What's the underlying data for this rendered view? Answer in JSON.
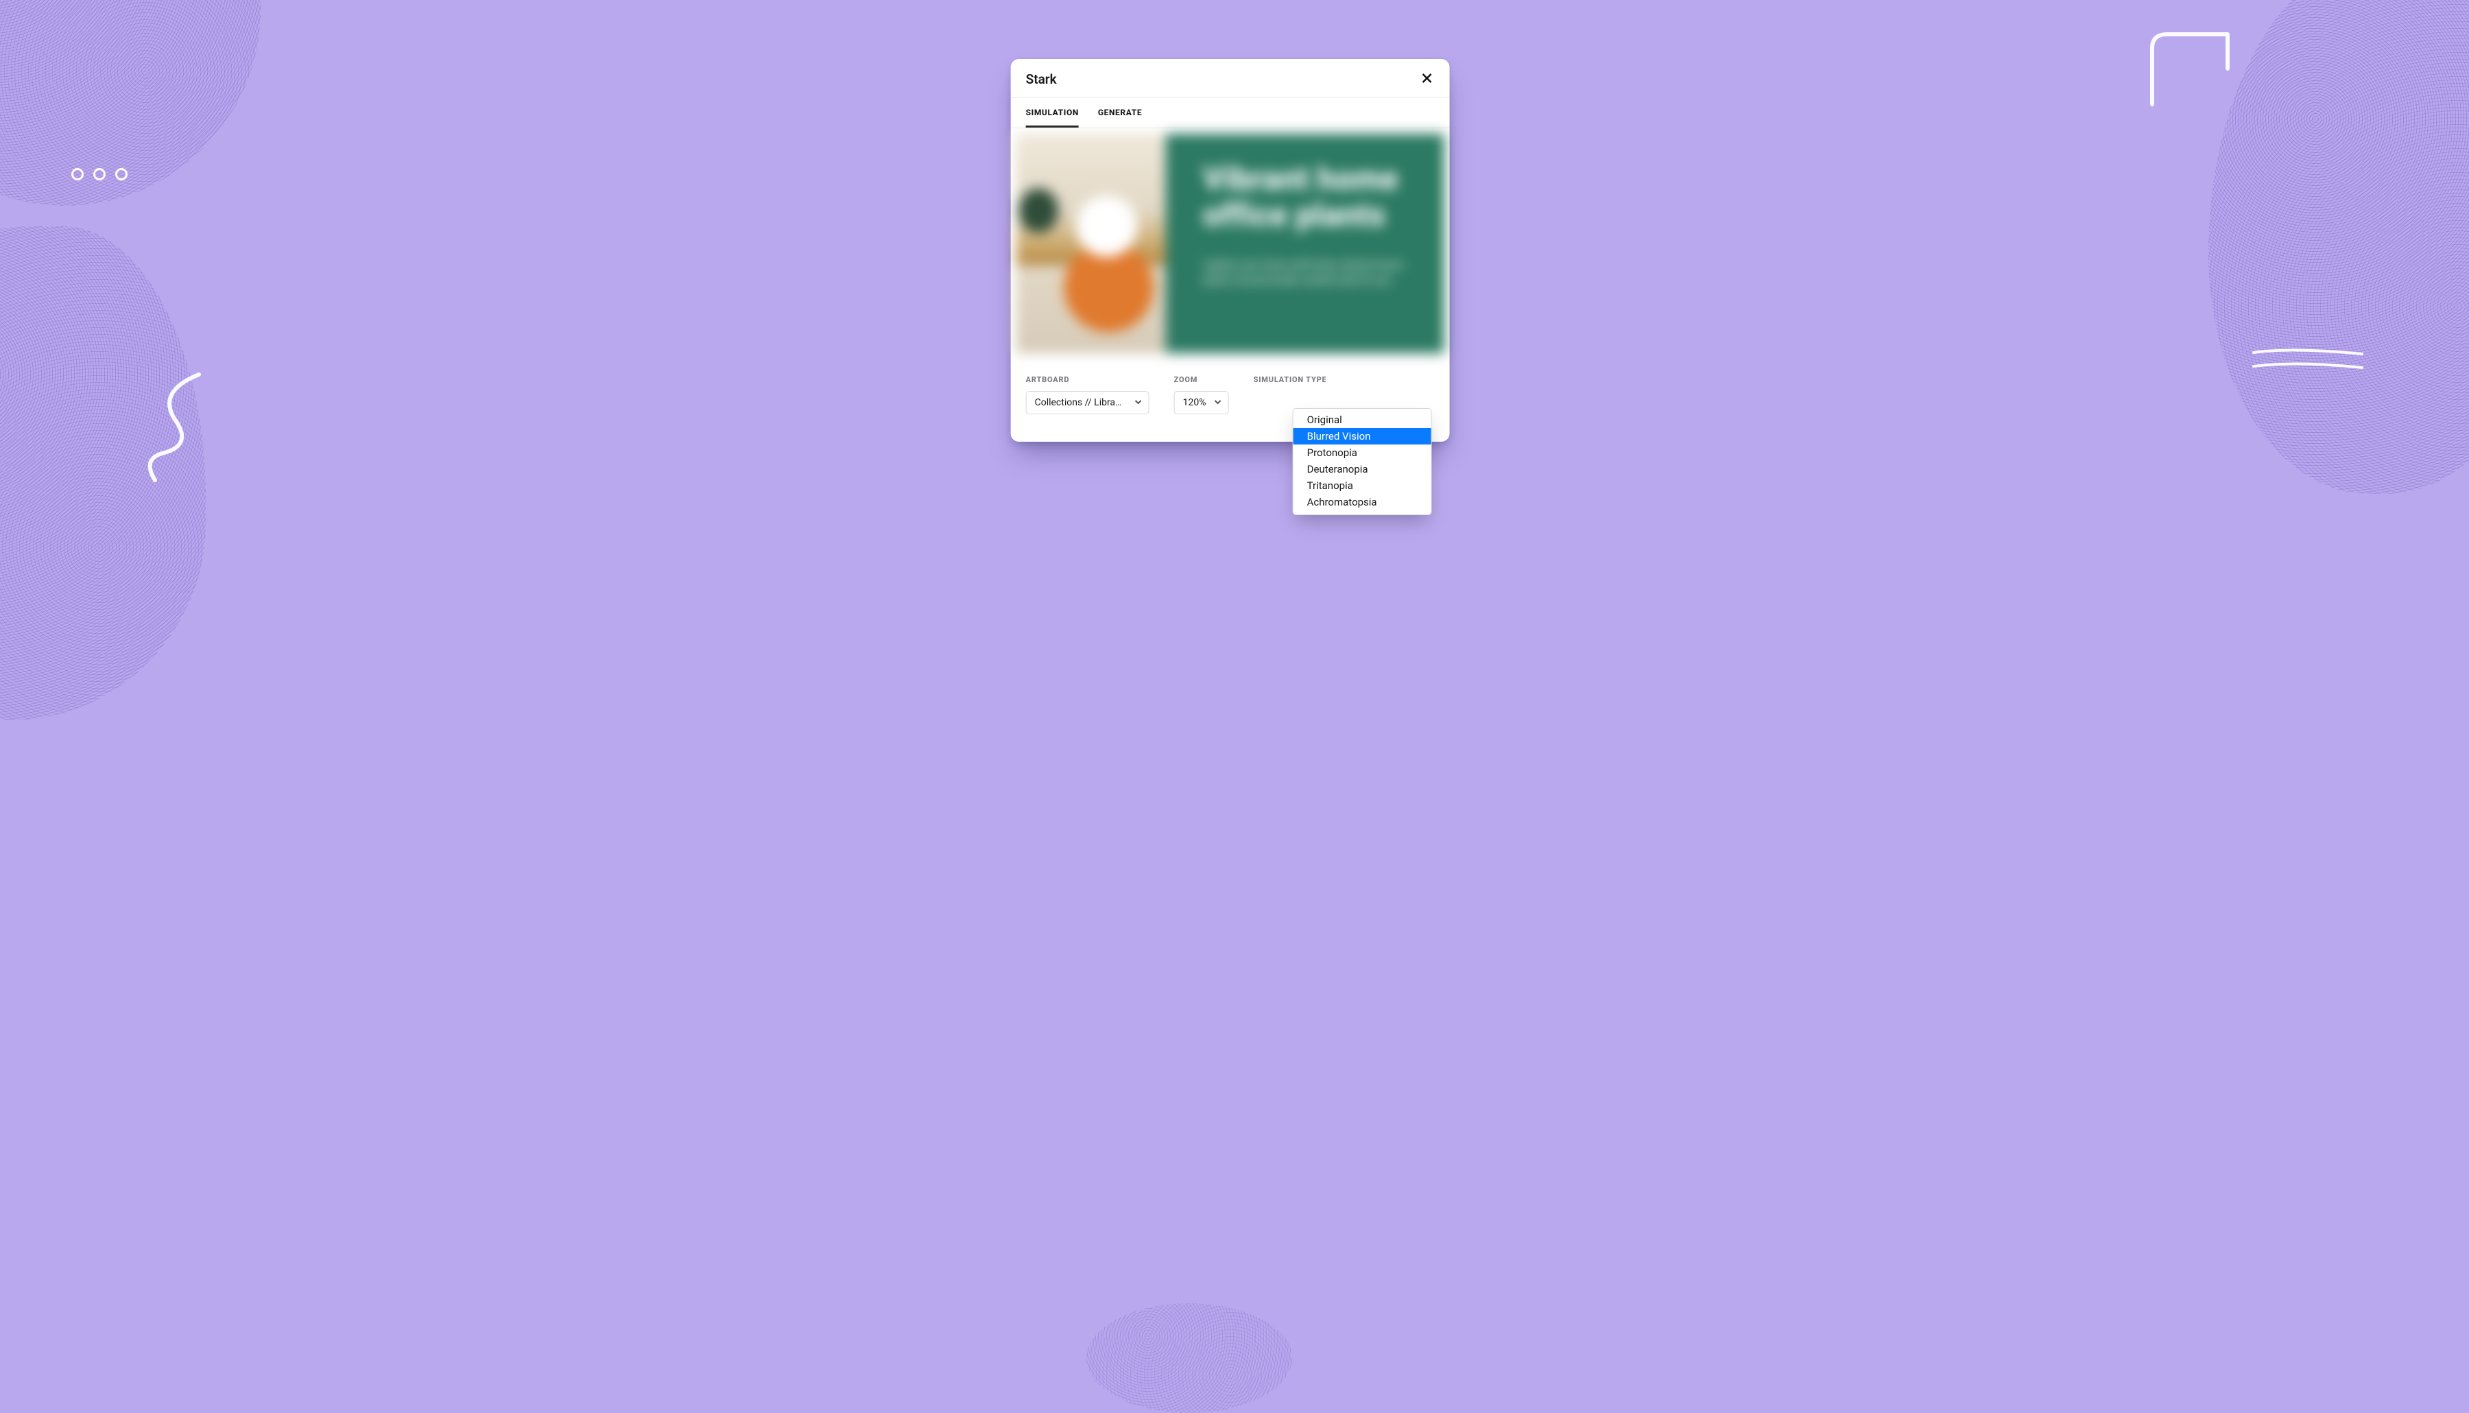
{
  "panel": {
    "title": "Stark"
  },
  "tabs": {
    "simulation": "SIMULATION",
    "generate": "GENERATE",
    "active": "simulation"
  },
  "preview": {
    "headline": "Vibrant home office plants",
    "subtext": "Lighten your home with these vibrant house plants we personally curated only for you"
  },
  "controls": {
    "artboard": {
      "label": "ARTBOARD",
      "value": "Collections // Libra…"
    },
    "zoom": {
      "label": "ZOOM",
      "value": "120%"
    },
    "simType": {
      "label": "SIMULATION TYPE",
      "options": [
        "Original",
        "Blurred Vision",
        "Protonopia",
        "Deuteranopia",
        "Tritanopia",
        "Achromatopsia"
      ],
      "selected": "Blurred Vision"
    }
  }
}
